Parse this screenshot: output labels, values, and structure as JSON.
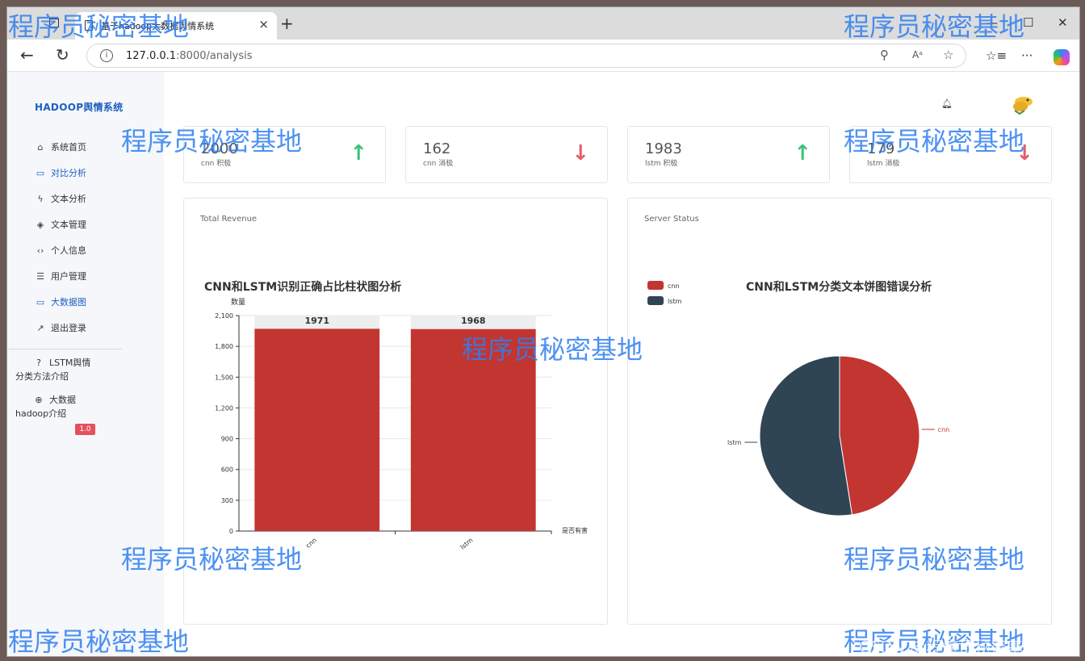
{
  "browser": {
    "tab_title": "基于hadoop大数据舆情系统",
    "url_host": "127.0.0.1",
    "url_path": ":8000/analysis",
    "new_tab": "+",
    "tab_close": "×",
    "more": "···"
  },
  "sidebar": {
    "brand": "HADOOP舆情系统",
    "items": [
      {
        "icon": "home-icon",
        "label": "系统首页",
        "active": false
      },
      {
        "icon": "monitor-icon",
        "label": "对比分析",
        "active": true
      },
      {
        "icon": "bolt-icon",
        "label": "文本分析",
        "active": false
      },
      {
        "icon": "layers-icon",
        "label": "文本管理",
        "active": false
      },
      {
        "icon": "code-icon",
        "label": "个人信息",
        "active": false
      },
      {
        "icon": "list-icon",
        "label": "用户管理",
        "active": false
      },
      {
        "icon": "monitor-icon",
        "label": "大数据图",
        "active": true
      },
      {
        "icon": "trend-icon",
        "label": "退出登录",
        "active": false
      }
    ],
    "help": [
      {
        "icon": "question-icon",
        "line1": "LSTM舆情",
        "line2": "分类方法介绍"
      },
      {
        "icon": "globe-icon",
        "line1": "大数据",
        "line2": "hadoop介绍"
      }
    ],
    "version": "1.0"
  },
  "stats": [
    {
      "value": "2000",
      "label": "cnn 积极",
      "trend": "up"
    },
    {
      "value": "162",
      "label": "cnn 消极",
      "trend": "down"
    },
    {
      "value": "1983",
      "label": "lstm 积极",
      "trend": "up"
    },
    {
      "value": "179",
      "label": "lstm 消极",
      "trend": "down"
    }
  ],
  "panels": {
    "left_title": "Total Revenue",
    "right_title": "Server Status"
  },
  "chart_data": [
    {
      "type": "bar",
      "title": "CNN和LSTM识别正确占比柱状图分析",
      "ylabel": "数量",
      "xlabel": "是否有害",
      "categories": [
        "cnn",
        "lstm"
      ],
      "values": [
        1971,
        1968
      ],
      "ylim": [
        0,
        2100
      ],
      "yticks": [
        0,
        300,
        600,
        900,
        1200,
        1500,
        1800,
        2100
      ],
      "ytick_labels": [
        "0",
        "300",
        "600",
        "900",
        "1,200",
        "1,500",
        "1,800",
        "2,100"
      ],
      "data_labels": [
        "1971",
        "1968"
      ],
      "color": "#c23531",
      "background_bar_color": "#eeeeee",
      "grid": true
    },
    {
      "type": "pie",
      "title": "CNN和LSTM分类文本饼图错误分析",
      "labels": [
        "cnn",
        "lstm"
      ],
      "values": [
        162,
        179
      ],
      "colors": [
        "#c23531",
        "#2f4554"
      ],
      "legend": [
        "cnn",
        "lstm"
      ],
      "legend_position": "top-left"
    }
  ],
  "watermark": "程序员秘密基地",
  "csdn_mark": "CSDN @程序员秘密基地"
}
